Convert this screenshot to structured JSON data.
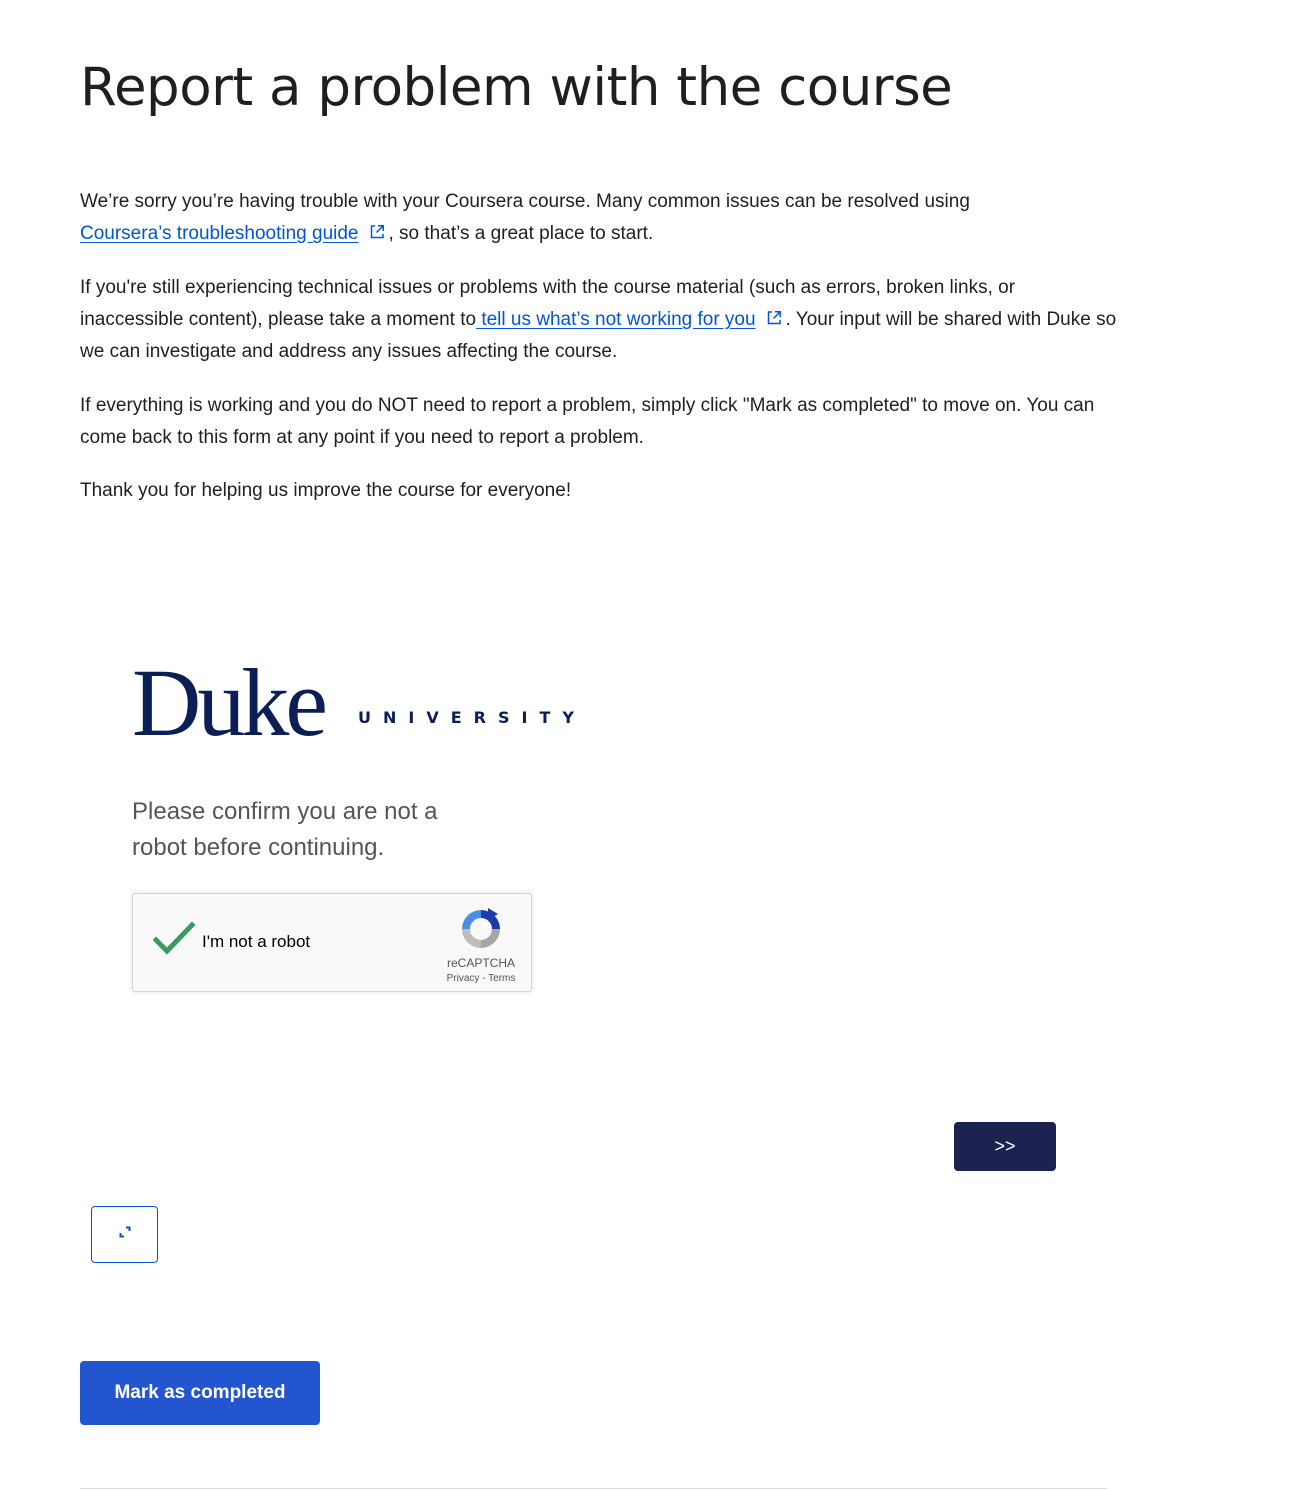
{
  "page": {
    "title": "Report a problem with the course"
  },
  "intro": {
    "p1_text_before": "We’re sorry you’re having trouble with your Coursera course. Many common issues can be resolved using ",
    "p1_link": "Coursera’s troubleshooting guide",
    "p1_text_after": ", so that’s a great place to start.",
    "p2_text_before": "If you're still experiencing technical issues or problems with the course material (such as errors, broken links, or inaccessible content), please take a moment to",
    "p2_link": " tell us what’s not working for you",
    "p2_text_after": ". Your input will be shared with Duke so we can investigate and address any issues affecting the course.",
    "p3_text": "If everything is working and you do NOT need to report a problem, simply click \"Mark as completed\" to move on. You can come back to this form at any point if you need to report a problem.",
    "p4_text": "Thank you for helping us improve the course for everyone!"
  },
  "form": {
    "logo_word": "Duke",
    "logo_sub": "UNIVERSITY",
    "confirm_text": "Please confirm you are not a robot before continuing.",
    "recaptcha": {
      "label": "I'm not a robot",
      "brand": "reCAPTCHA",
      "terms": "Privacy - Terms",
      "checked": true
    },
    "next_label": ">>"
  },
  "actions": {
    "mark_completed_label": "Mark as completed"
  },
  "colors": {
    "link": "#0056d2",
    "primary_button": "#2355cf",
    "next_button": "#1b2250",
    "duke_navy": "#0b1f56",
    "check_green": "#3c9a5f"
  },
  "icons": {
    "external_link": "external-link-icon",
    "expand": "expand-icon",
    "check": "checkmark-icon",
    "recaptcha": "recaptcha-logo-icon"
  }
}
